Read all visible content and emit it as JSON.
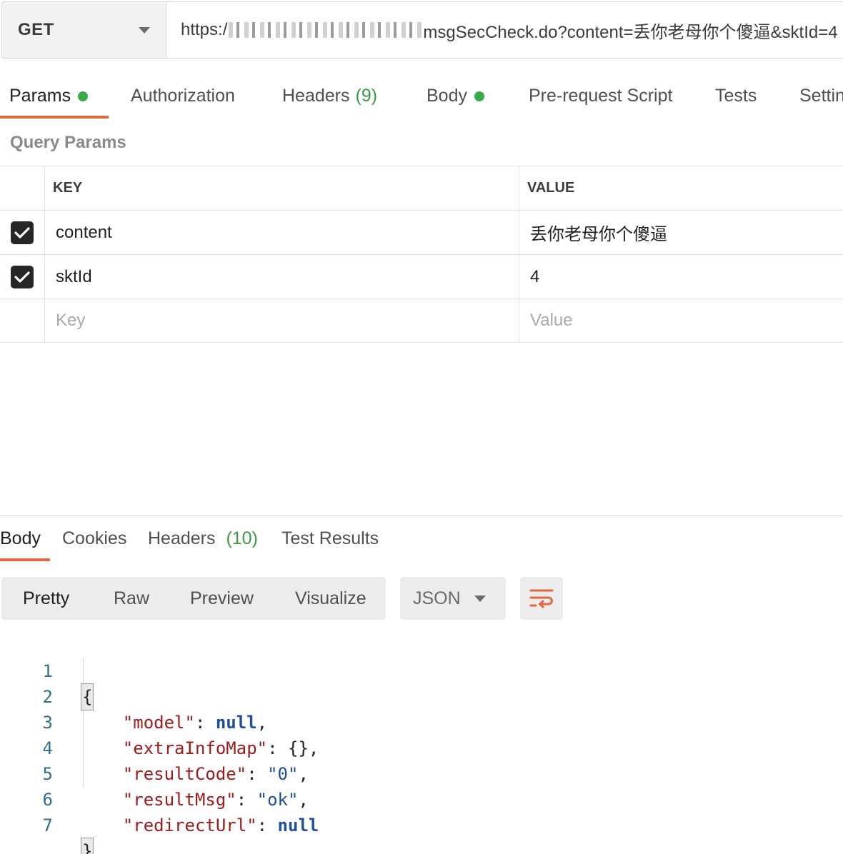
{
  "request": {
    "method": "GET",
    "url_prefix": "https:/",
    "url_suffix": "msgSecCheck.do?content=丢你老母你个傻逼&sktId=4"
  },
  "request_tabs": [
    {
      "label": "Params",
      "dot": true
    },
    {
      "label": "Authorization"
    },
    {
      "label": "Headers",
      "count": "(9)"
    },
    {
      "label": "Body",
      "dot": true
    },
    {
      "label": "Pre-request Script"
    },
    {
      "label": "Tests"
    },
    {
      "label": "Settin"
    }
  ],
  "query_params": {
    "title": "Query Params",
    "key_header": "KEY",
    "value_header": "VALUE",
    "rows": [
      {
        "key": "content",
        "value": "丢你老母你个傻逼",
        "checked": true
      },
      {
        "key": "sktId",
        "value": "4",
        "checked": true
      }
    ],
    "key_placeholder": "Key",
    "value_placeholder": "Value"
  },
  "response_tabs": [
    {
      "label": "Body"
    },
    {
      "label": "Cookies"
    },
    {
      "label": "Headers",
      "count": "(10)"
    },
    {
      "label": "Test Results"
    }
  ],
  "view_modes": [
    "Pretty",
    "Raw",
    "Preview",
    "Visualize"
  ],
  "format": "JSON",
  "wrap_icon": "wrap-lines-icon",
  "code": {
    "line_numbers": [
      "1",
      "2",
      "3",
      "4",
      "5",
      "6",
      "7"
    ],
    "open_brace": "{",
    "close_brace": "}",
    "fields": [
      {
        "key": "\"model\"",
        "value": "null",
        "type": "null",
        "trail": ","
      },
      {
        "key": "\"extraInfoMap\"",
        "value": "{}",
        "type": "plain",
        "trail": ","
      },
      {
        "key": "\"resultCode\"",
        "value": "\"0\"",
        "type": "string",
        "trail": ","
      },
      {
        "key": "\"resultMsg\"",
        "value": "\"ok\"",
        "type": "string",
        "trail": ","
      },
      {
        "key": "\"redirectUrl\"",
        "value": "null",
        "type": "null",
        "trail": ""
      }
    ]
  },
  "colors": {
    "accent": "#e0683f",
    "green": "#3aa94a",
    "json_key": "#9b1a1a",
    "json_value": "#1f4f9b"
  }
}
